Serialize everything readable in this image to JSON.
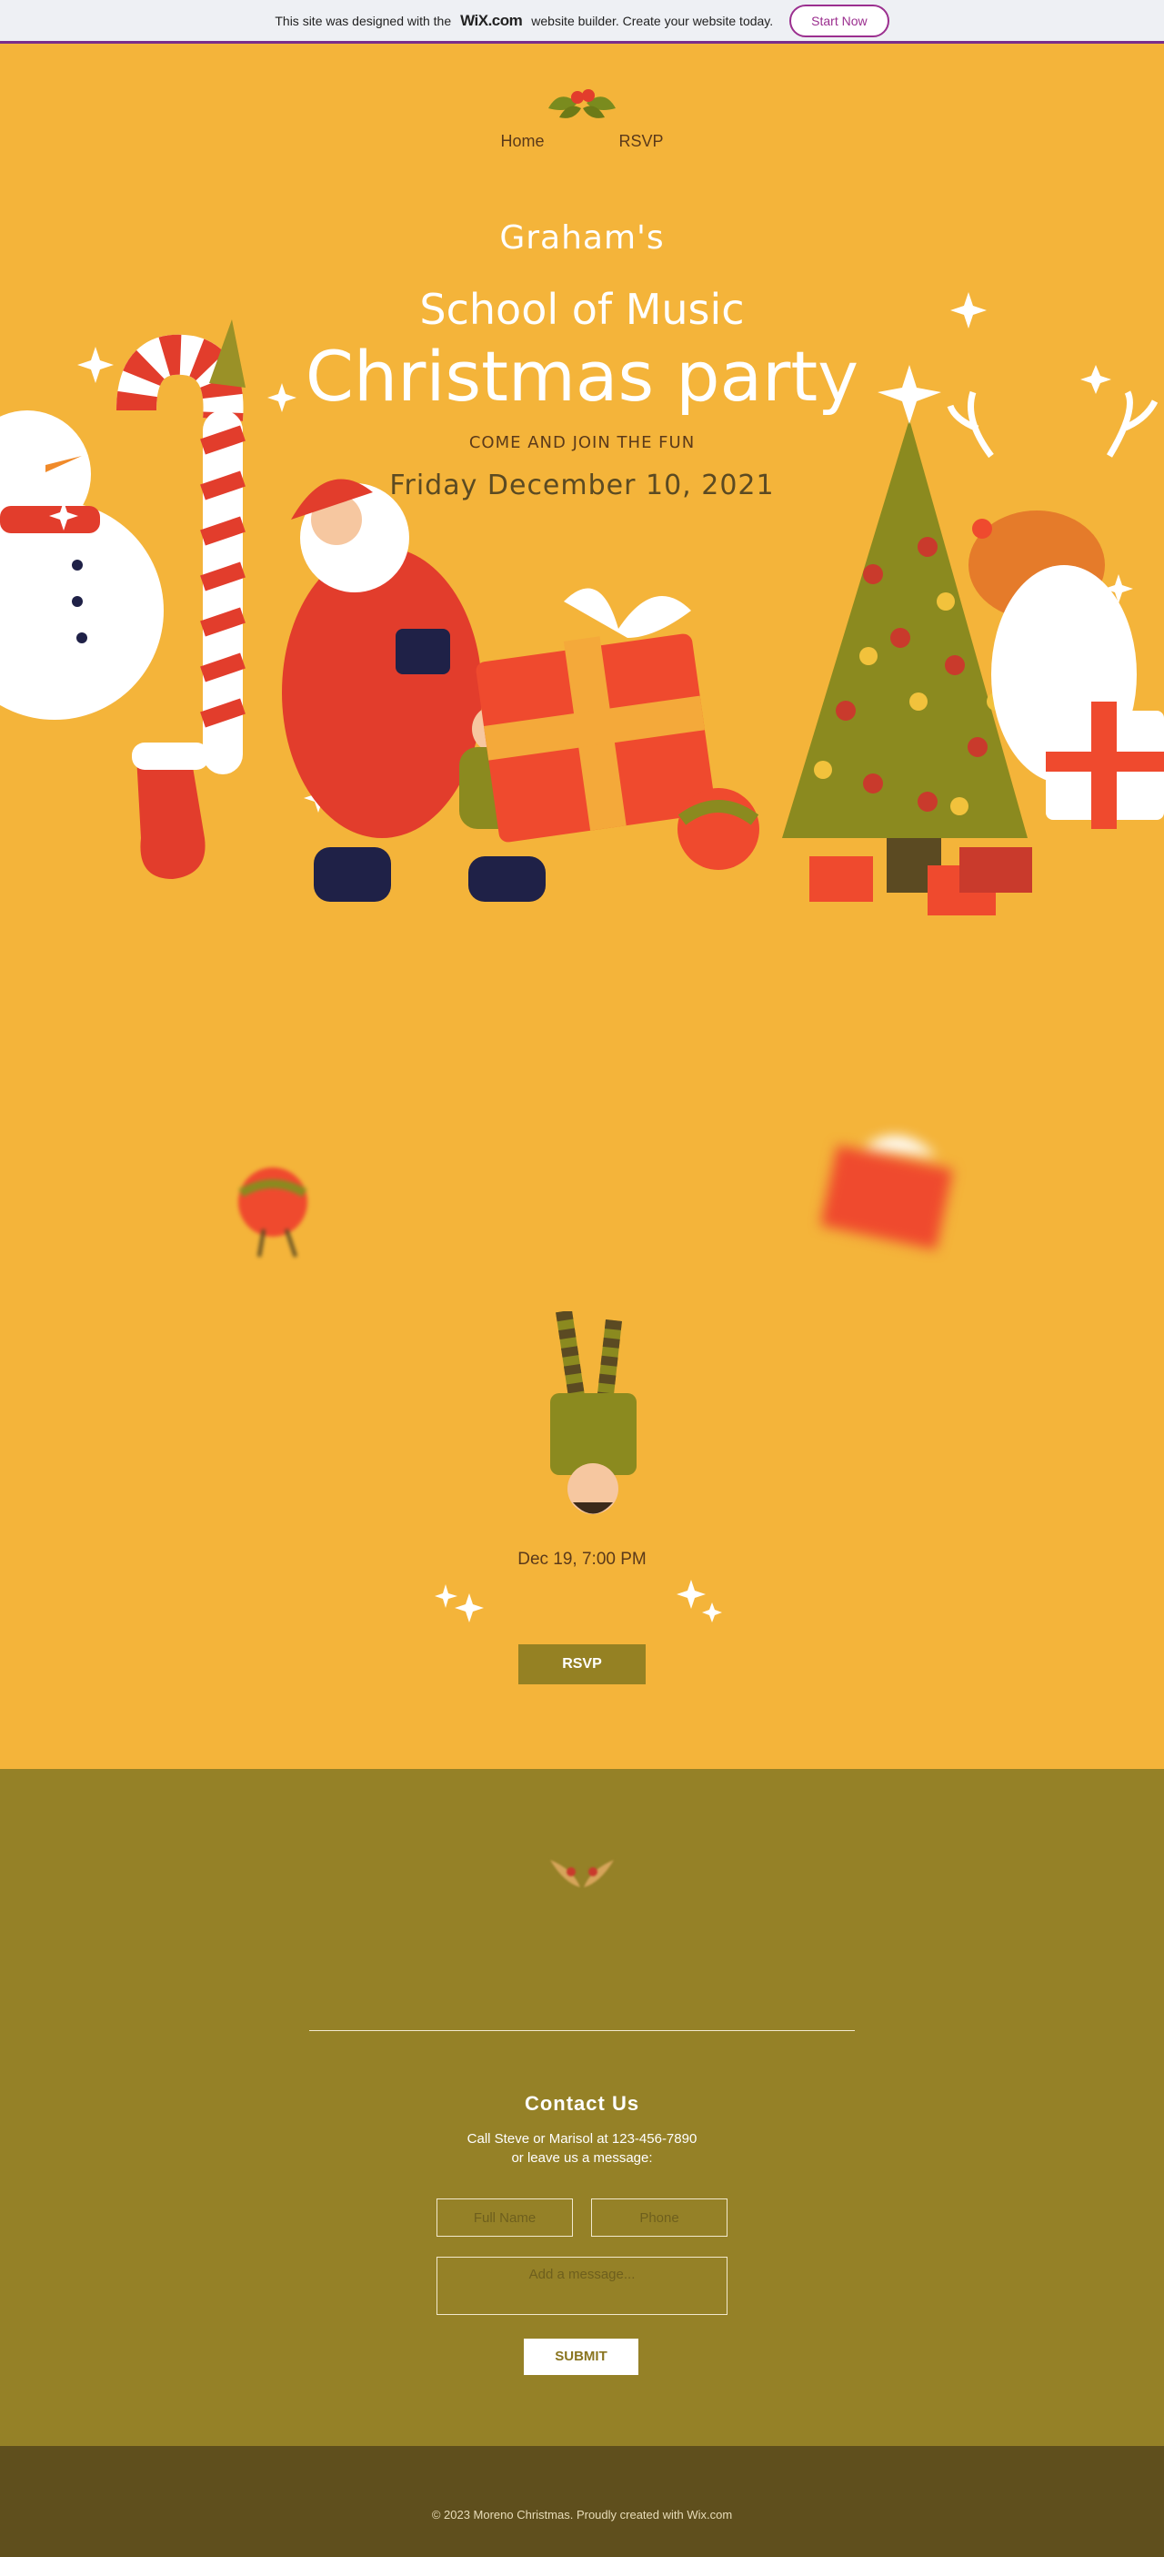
{
  "wix_banner": {
    "text_before": "This site was designed with the",
    "brand": "WiX.com",
    "text_after": "website builder. Create your website today.",
    "cta": "Start Now"
  },
  "nav": {
    "items": [
      "Home",
      "RSVP"
    ]
  },
  "hero": {
    "line1": "Graham's",
    "line2": "School of Music",
    "line3": "Christmas party",
    "tagline": "COME AND JOIN THE FUN",
    "date": "Friday December 10, 2021"
  },
  "event": {
    "datetime": "Dec 19, 7:00 PM",
    "button": "RSVP"
  },
  "contact": {
    "title": "Contact Us",
    "line1": "Call Steve or Marisol at 123-456-7890",
    "line2": "or leave us a message:",
    "name_placeholder": "Full Name",
    "phone_placeholder": "Phone",
    "message_placeholder": "Add a message...",
    "submit": "SUBMIT"
  },
  "footer": {
    "text": "© 2023 Moreno Christmas. Proudly created with Wix.com"
  },
  "colors": {
    "page_bg": "#f4b43a",
    "olive": "#958127",
    "dark_olive": "#5f4f1d",
    "accent_purple": "#9b2f8f",
    "red": "#e84a35"
  },
  "icons": [
    "holly-icon",
    "sparkle-icon",
    "snowman-illustration",
    "candy-cane-illustration",
    "santa-illustration",
    "gift-box-illustration",
    "christmas-tree-illustration",
    "reindeer-illustration",
    "stocking-illustration",
    "ornament-illustration",
    "elf-illustration"
  ]
}
